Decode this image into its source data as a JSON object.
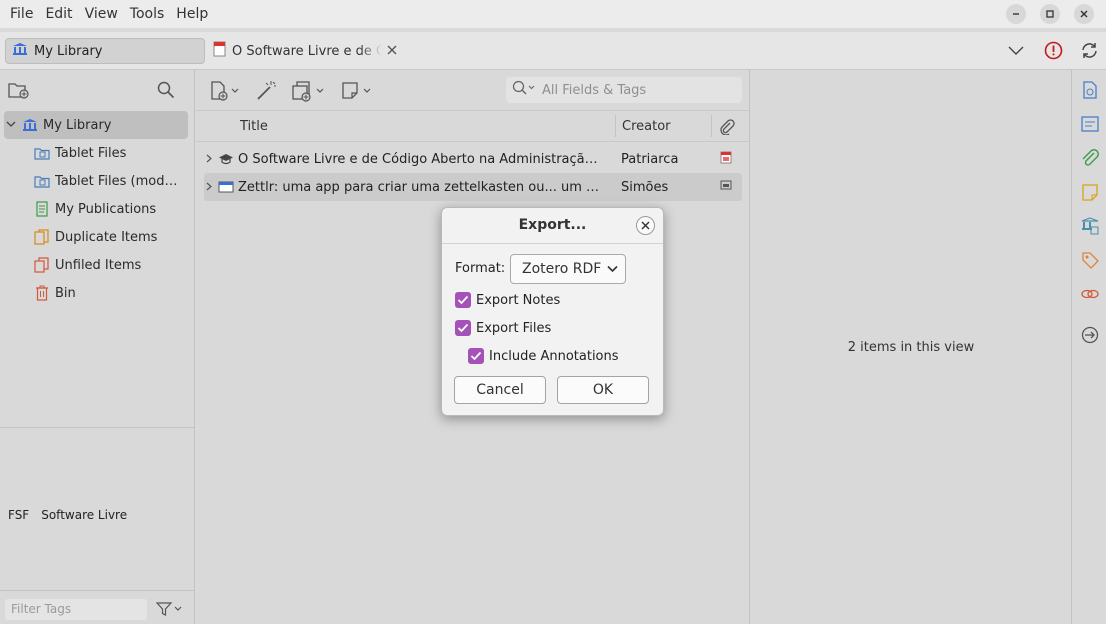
{
  "menubar": {
    "items": [
      "File",
      "Edit",
      "View",
      "Tools",
      "Help"
    ]
  },
  "tabs": {
    "library": "My Library",
    "document": "O Software Livre e de Código Aberto na Administração Pública"
  },
  "collections": {
    "items": [
      {
        "label": "My Library",
        "icon": "library-icon"
      },
      {
        "label": "Tablet Files",
        "icon": "tablet-folder-icon"
      },
      {
        "label": "Tablet Files (modified)",
        "icon": "tablet-folder-icon"
      },
      {
        "label": "My Publications",
        "icon": "publications-icon"
      },
      {
        "label": "Duplicate Items",
        "icon": "duplicate-icon"
      },
      {
        "label": "Unfiled Items",
        "icon": "unfiled-icon"
      },
      {
        "label": "Bin",
        "icon": "trash-icon"
      }
    ]
  },
  "tags": {
    "items": [
      "FSF",
      "Software Livre"
    ],
    "filter_placeholder": "Filter Tags"
  },
  "search": {
    "placeholder": "All Fields & Tags"
  },
  "columns": {
    "title": "Title",
    "creator": "Creator"
  },
  "items": [
    {
      "title": "O Software Livre e de Código Aberto na Administração Pública: ...",
      "creator": "Patriarca",
      "type": "thesis-icon",
      "attachment": "pdf-icon"
    },
    {
      "title": "Zettlr: uma app para criar uma zettelkasten ou... um segundo cérebro",
      "creator": "Simões",
      "type": "webpage-icon",
      "attachment": "snapshot-icon"
    }
  ],
  "itempane": {
    "count_text": "2 items in this view"
  },
  "dialog": {
    "title": "Export...",
    "format_label": "Format:",
    "format_value": "Zotero RDF",
    "export_notes": {
      "label": "Export Notes",
      "checked": true
    },
    "export_files": {
      "label": "Export Files",
      "checked": true
    },
    "include_annotations": {
      "label": "Include Annotations",
      "checked": true
    },
    "cancel": "Cancel",
    "ok": "OK"
  },
  "colors": {
    "accent_checkbox": "#a451b8",
    "error": "#c21a1a",
    "library_blue": "#3a6fd8"
  }
}
